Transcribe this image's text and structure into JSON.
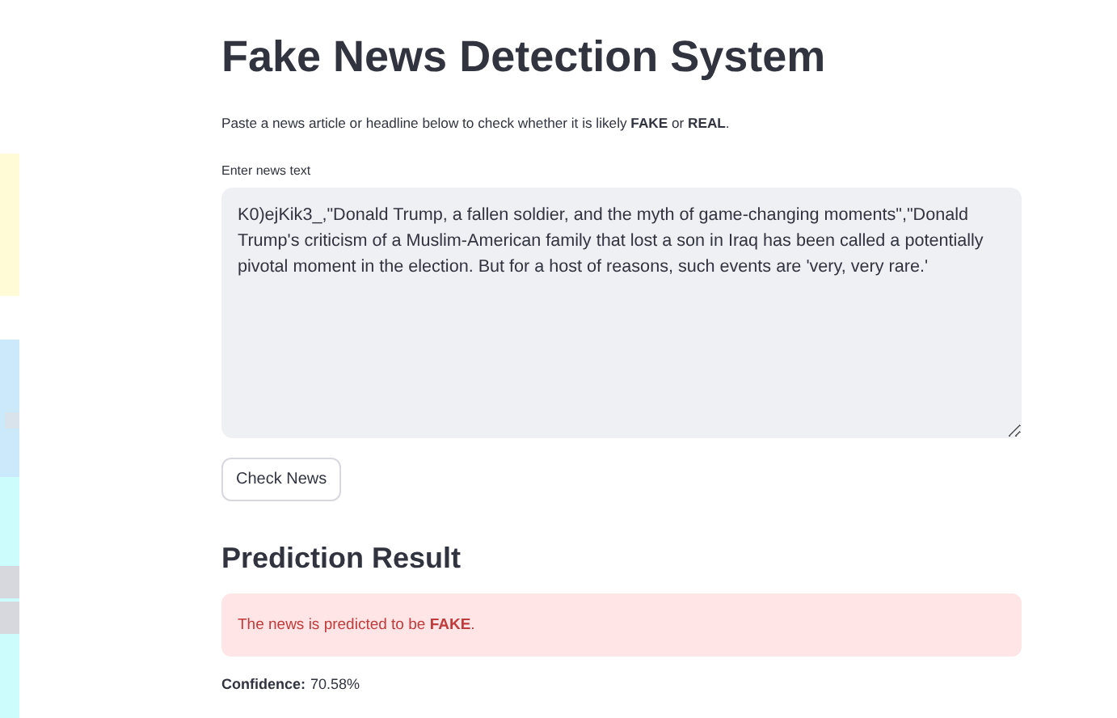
{
  "title": "Fake News Detection System",
  "intro": "Paste a news article or headline below to check whether it is likely **FAKE** or **REAL**.",
  "input": {
    "label": "Enter news text",
    "value": "K0)ejKik3_,\"Donald Trump, a fallen soldier, and the myth of game-changing moments\",\"Donald Trump's criticism of a Muslim-American family that lost a son in Iraq has been called a potentially pivotal moment in the election. But for a host of reasons, such events are 'very, very rare.'"
  },
  "button": "Check News",
  "result": {
    "heading": "Prediction Result",
    "kind": "error",
    "message": "The news is predicted to be **FAKE**.",
    "confidence_label": "Confidence:",
    "confidence": "70.58%"
  }
}
